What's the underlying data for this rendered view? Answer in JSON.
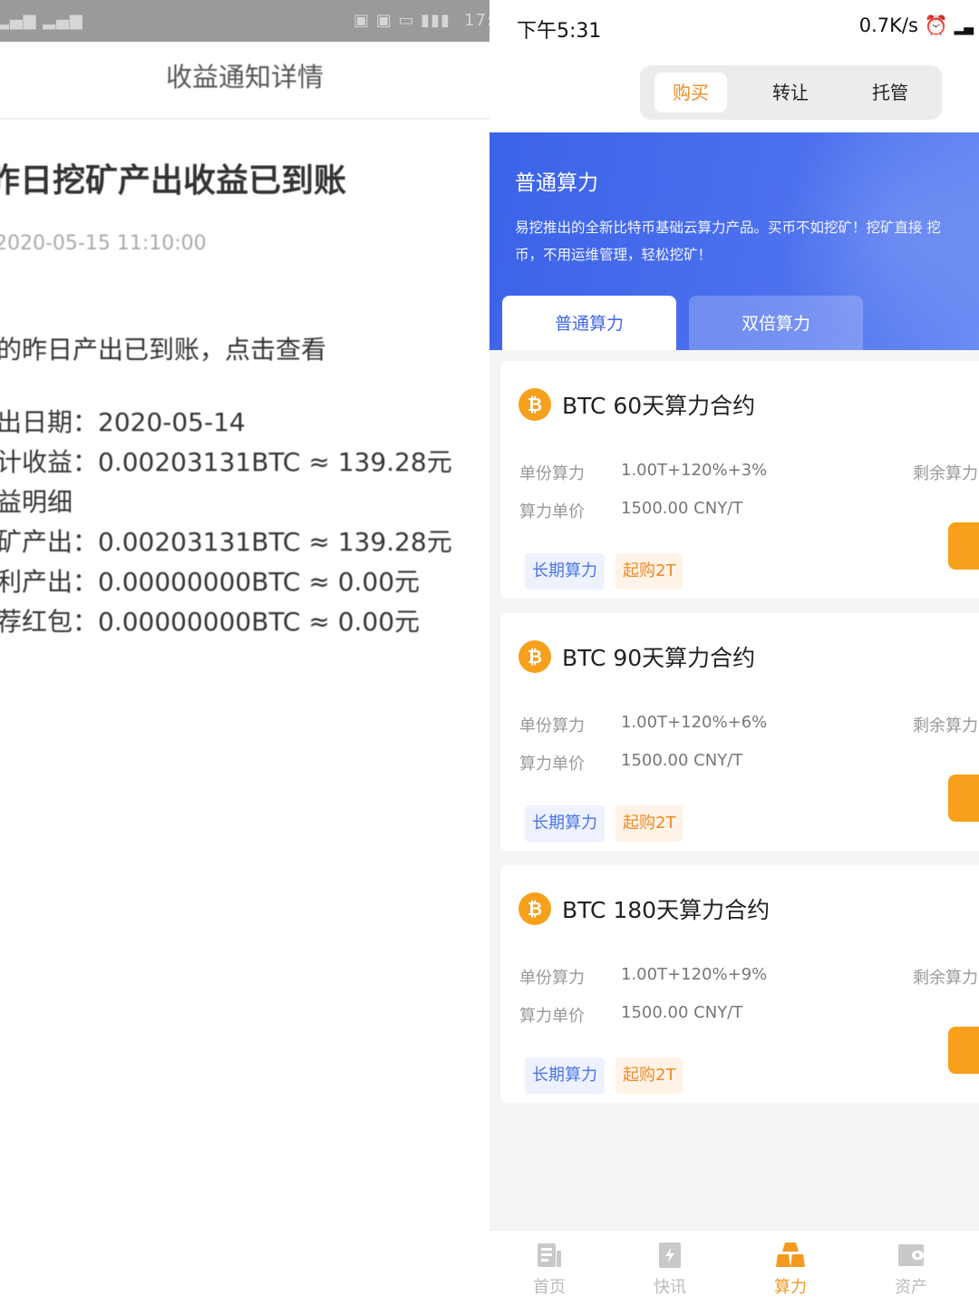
{
  "left": {
    "nav_title": "收益通知详情",
    "message_title": "昨日挖矿产出收益已到账",
    "message_time": "2020-05-15 11:10:00",
    "summary": "的昨日产出已到账，点击查看",
    "detail_lines": [
      "出日期：2020-05-14",
      "计收益：0.00203131BTC ≈ 139.28元",
      "益明细",
      "矿产出：0.00203131BTC ≈ 139.28元",
      "利产出：0.00000000BTC ≈ 0.00元",
      "荐红包：0.00000000BTC ≈ 0.00元"
    ],
    "status_right": "17:"
  },
  "right": {
    "status": {
      "time": "下午5:31",
      "speed": "0.7K/s"
    },
    "segments": [
      {
        "label": "购买",
        "active": true
      },
      {
        "label": "转让",
        "active": false
      },
      {
        "label": "托管",
        "active": false
      }
    ],
    "banner": {
      "title": "普通算力",
      "desc_line1": "易挖推出的全新比特币基础云算力产品。买币不如挖矿！挖矿直接 挖",
      "desc_line2": "币，不用运维管理，轻松挖矿！",
      "tabs": [
        {
          "label": "普通算力",
          "active": true
        },
        {
          "label": "双倍算力",
          "active": false
        }
      ]
    },
    "cards": [
      {
        "title": "BTC 60天算力合约",
        "unit_label": "单份算力",
        "unit_value": "1.00T+120%+3%",
        "price_label": "算力单价",
        "price_value": "1500.00 CNY/T",
        "remain_label": "剩余算力",
        "tag1": "长期算力",
        "tag2": "起购2T"
      },
      {
        "title": "BTC 90天算力合约",
        "unit_label": "单份算力",
        "unit_value": "1.00T+120%+6%",
        "price_label": "算力单价",
        "price_value": "1500.00 CNY/T",
        "remain_label": "剩余算力",
        "tag1": "长期算力",
        "tag2": "起购2T"
      },
      {
        "title": "BTC 180天算力合约",
        "unit_label": "单份算力",
        "unit_value": "1.00T+120%+9%",
        "price_label": "算力单价",
        "price_value": "1500.00 CNY/T",
        "remain_label": "剩余算力",
        "tag1": "长期算力",
        "tag2": "起购2T"
      }
    ],
    "tabbar": [
      {
        "label": "首页",
        "icon": "home-icon",
        "active": false
      },
      {
        "label": "快讯",
        "icon": "news-icon",
        "active": false
      },
      {
        "label": "算力",
        "icon": "hashrate-icon",
        "active": true
      },
      {
        "label": "资产",
        "icon": "wallet-icon",
        "active": false
      }
    ],
    "colors": {
      "accent": "#f7a01c",
      "primary": "#4166e9",
      "tag_blue_text": "#4b74e8",
      "tag_orange_text": "#f08a24"
    }
  }
}
